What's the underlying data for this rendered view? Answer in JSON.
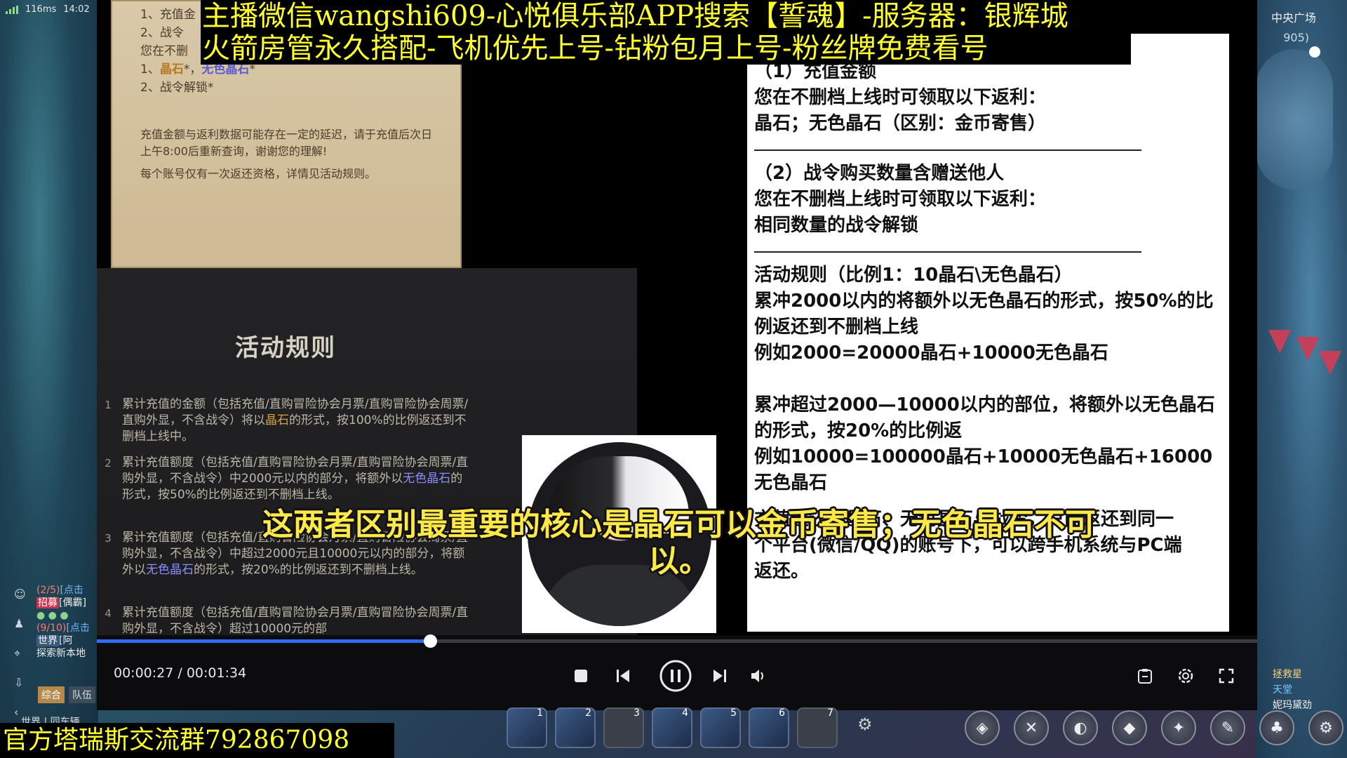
{
  "hud": {
    "ping": "116ms",
    "clock": "14:02",
    "location": "中央广场",
    "coords": "905)"
  },
  "streamer_banner": {
    "line1": "主播微信wangshi609-心悦俱乐部APP搜索【誓魂】-服务器：银辉城",
    "line2": "火箭房管永久搭配-飞机优先上号-钻粉包月上号-粉丝牌免费看号"
  },
  "scroll_card": {
    "l1": "1、充值金",
    "l2": "2、战令",
    "l3": "您在不删",
    "l4_num": "1、",
    "l4_gold": "晶石",
    "l4_sep": "*，",
    "l4_blue": "无色晶石",
    "l4_end": "*",
    "l5": "2、战令解锁*",
    "notice1": "充值金额与返利数据可能存在一定的延迟，请于充值后次日上午8:00后重新查询，谢谢您的理解!",
    "notice2": "每个账号仅有一次返还资格，详情见活动规则。"
  },
  "rules": {
    "title": "活动规则",
    "items": [
      {
        "num": "1",
        "a": "累计充值的金额（包括充值/直购冒险协会月票/直购冒险协会周票/直购外显，不含战令）将以",
        "gold": "晶石",
        "b": "的形式，按100%的比例返还到不删档上线中。"
      },
      {
        "num": "2",
        "a": "累计充值额度（包括充值/直购冒险协会月票/直购冒险协会周票/直购外显，不含战令）中2000元以内的部分，将额外以",
        "blue": "无色晶石",
        "b": "的形式，按50%的比例返还到不删档上线。"
      },
      {
        "num": "3",
        "a": "累计充值额度（包括充值/直购冒险协会月票/直购冒险协会周票/直购外显，不含战令）中超过2000元且10000元以内的部分，将额外以",
        "blue": "无色晶石",
        "b": "的形式，按20%的比例返还到不删档上线。"
      },
      {
        "num": "4",
        "a": "累计充值额度（包括充值/直购冒险协会月票/直购冒险协会周票/直购外显，不含战令）超过10000元的部",
        "b": ""
      }
    ]
  },
  "white_doc": {
    "s1_title": "（1）充值金额",
    "s1_l1": "您在不删档上线时可领取以下返利：",
    "s1_l2": "晶石；无色晶石（区别：金币寄售）",
    "s2_title": "（2）战令购买数量含赠送他人",
    "s2_l1": "您在不删档上线时可领取以下返利：",
    "s2_l2": "相同数量的战令解锁",
    "r_title": "活动规则（比例1：10晶石\\无色晶石）",
    "r1": "累冲2000以内的将额外以无色晶石的形式，按50%的比例返还到不删档上线",
    "r1_ex": "例如2000=20000晶石+10000无色晶石",
    "r2": "累冲超过2000—10000以内的部位，将额外以无色晶石的形式，按20%的比例返",
    "r2_ex": "例如10000=100000晶石+10000无色晶石+16000无色晶石",
    "r3_partial": "充值返还的晶石、无色晶石与战令，只能返还到同一",
    "r3_l2": "个平台(微信/QQ)的账号下，可以跨手机系统与PC端",
    "r3_l3": "返还。"
  },
  "subtitle": {
    "line1": "这两者区别最重要的核心是晶石可以金币寄售；无色晶石不可",
    "line2": "以。"
  },
  "player": {
    "current_time": "00:00:27",
    "duration": "00:01:34",
    "progress": 0.287
  },
  "chat": {
    "line1_cnt": "(2/5)",
    "line1_link": "[点击",
    "line2_tag": "招募",
    "line2_text": "[偶霸]",
    "line3_cnt": "(9/10)",
    "line3_link": "[点击",
    "line4_tag": "世界",
    "line4_text": "[阿",
    "line5": "探索新本地",
    "tab_active": "综合",
    "tab2": "队伍",
    "world": "世界",
    "world2": "同车辆"
  },
  "group_banner": "官方塔瑞斯交流群792867098",
  "skills": [
    "1",
    "2",
    "3",
    "4",
    "5",
    "6",
    "7"
  ],
  "right_labels": {
    "l1": "拯救星",
    "l2": "天堂",
    "l3": "妮玛黛劲"
  }
}
